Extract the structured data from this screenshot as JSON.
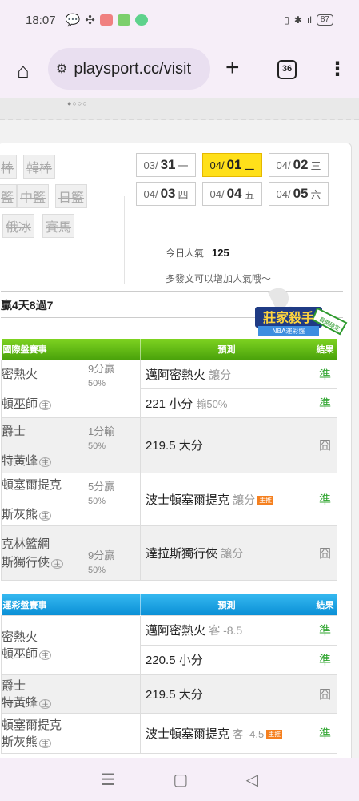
{
  "status": {
    "time": "18:07",
    "battery": "87"
  },
  "browser": {
    "url": "playsport.cc/visit",
    "tab_count": "36"
  },
  "leagues": [
    "韓棒",
    "中籃",
    "日籃",
    "俄冰",
    "賽馬"
  ],
  "dates": [
    {
      "md": "03/",
      "d": "31",
      "wd": "一",
      "active": false
    },
    {
      "md": "04/",
      "d": "01",
      "wd": "二",
      "active": true
    },
    {
      "md": "04/",
      "d": "02",
      "wd": "三",
      "active": false
    },
    {
      "md": "04/",
      "d": "03",
      "wd": "四",
      "active": false
    },
    {
      "md": "04/",
      "d": "04",
      "wd": "五",
      "active": false
    },
    {
      "md": "04/",
      "d": "05",
      "wd": "六",
      "active": false
    }
  ],
  "popularity": {
    "label": "今日人氣",
    "value": "125",
    "tip": "多發文可以增加人氣哦～"
  },
  "badge": {
    "title": "莊家殺手",
    "sub": "NBA運彩盤",
    "tag": "長期穩定"
  },
  "record": "贏4天8過7",
  "home_mark": "主",
  "section1": {
    "headers": [
      "國際盤賽事",
      "預測",
      "結果"
    ],
    "rows": [
      {
        "team1": "密熱火",
        "team2": "頓巫師",
        "odds": "9分贏",
        "odds2": "50%",
        "pred": "邁阿密熱火",
        "pred_sub": "讓分",
        "result": "準"
      },
      {
        "pred": "221 小分",
        "pred_sub": "輸50%",
        "result": "準"
      },
      {
        "team1": "爵士",
        "team2": "特黃蜂",
        "odds": "1分輸",
        "odds2": "50%",
        "pred": "219.5 大分",
        "pred_sub": "",
        "result": "囧"
      },
      {
        "team1": "頓塞爾提克",
        "team2": "斯灰熊",
        "odds": "5分贏",
        "odds2": "50%",
        "pred": "波士頓塞爾提克",
        "pred_sub": "讓分",
        "fire": "主推",
        "result": "準"
      },
      {
        "team1": "克林籃網",
        "team2": "斯獨行俠",
        "odds": "9分贏",
        "odds2": "50%",
        "pred": "達拉斯獨行俠",
        "pred_sub": "讓分",
        "result": "囧"
      }
    ]
  },
  "section2": {
    "headers": [
      "運彩盤賽事",
      "預測",
      "結果"
    ],
    "rows": [
      {
        "team1": "密熱火",
        "team2": "頓巫師",
        "pred": "邁阿密熱火",
        "pred_sub": "客 -8.5",
        "result": "準"
      },
      {
        "pred": "220.5 小分",
        "result": "準"
      },
      {
        "team1": "爵士",
        "team2": "特黃蜂",
        "pred": "219.5 大分",
        "result": "囧"
      },
      {
        "team1": "頓塞爾提克",
        "team2": "斯灰熊",
        "pred": "波士頓塞爾提克",
        "pred_sub": "客 -4.5",
        "fire": "主推",
        "result": "準"
      }
    ]
  },
  "nav": {
    "recent": "☰",
    "home": "▢",
    "back": "◁"
  }
}
